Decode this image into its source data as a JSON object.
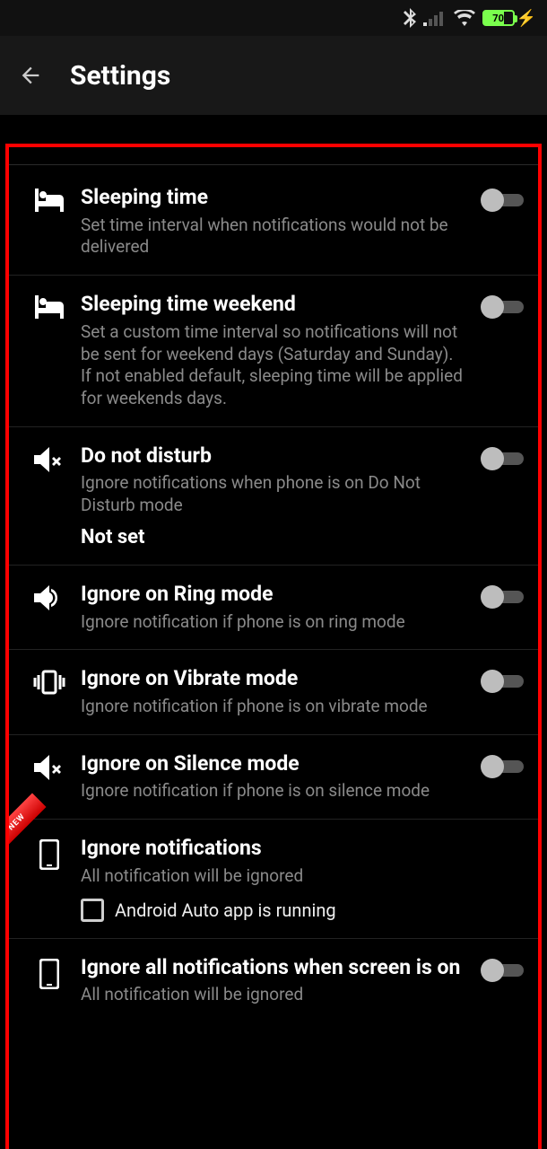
{
  "status": {
    "battery": "70"
  },
  "header": {
    "title": "Settings"
  },
  "ribbon": "NEW",
  "items": [
    {
      "title": "Sleeping time",
      "desc": "Set time interval when notifications would not be delivered"
    },
    {
      "title": "Sleeping time weekend",
      "desc": "Set a custom time interval so notifications will not be sent for weekend days (Saturday and Sunday). If not enabled default, sleeping time will be applied for weekends days."
    },
    {
      "title": "Do not disturb",
      "desc": "Ignore notifications when phone is on Do Not Disturb mode",
      "extra": "Not set"
    },
    {
      "title": "Ignore on Ring mode",
      "desc": "Ignore notification if phone is on ring mode"
    },
    {
      "title": "Ignore on Vibrate mode",
      "desc": "Ignore notification if phone is on vibrate mode"
    },
    {
      "title": "Ignore on Silence mode",
      "desc": "Ignore notification if phone is on silence mode"
    },
    {
      "title": "Ignore notifications",
      "desc": "All notification will be ignored",
      "check_label": "Android Auto app is running"
    },
    {
      "title": "Ignore all notifications when screen is on",
      "desc": "All notification will be ignored"
    }
  ]
}
